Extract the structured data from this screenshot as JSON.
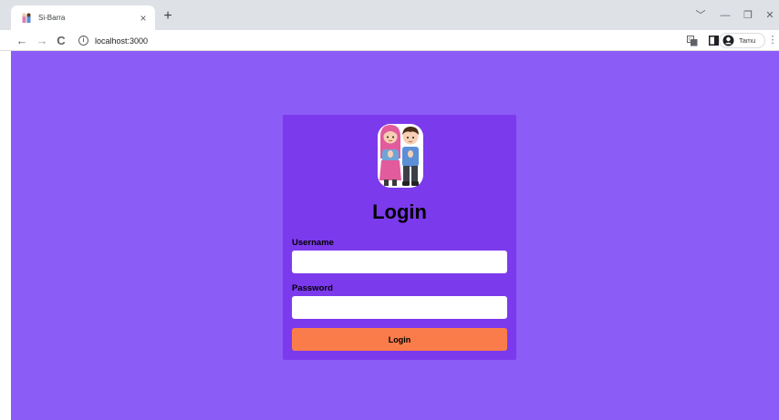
{
  "browser": {
    "tab": {
      "title": "Si-Barra",
      "favicon": "couple-favicon",
      "close_glyph": "×"
    },
    "new_tab_glyph": "+",
    "window_controls": {
      "tab_search": "﹀",
      "minimize": "—",
      "restore": "❐",
      "close": "✕"
    },
    "nav": {
      "back": "←",
      "forward": "→",
      "reload": "C"
    },
    "address": {
      "security_icon": "info-icon",
      "url": "localhost:3000"
    },
    "toolbar_icons": [
      "translate-icon",
      "side-panel-icon",
      "profile-icon"
    ],
    "profile": {
      "name": "Tamu"
    },
    "menu_glyph": "⋮"
  },
  "page": {
    "background_color": "#8b5cf6",
    "card_color": "#7c3aed",
    "mascot_icon": "couple-mascot",
    "title": "Login",
    "username_label": "Username",
    "username_value": "",
    "password_label": "Password",
    "password_value": "",
    "login_button": "Login",
    "button_color": "#fb7c4b"
  }
}
